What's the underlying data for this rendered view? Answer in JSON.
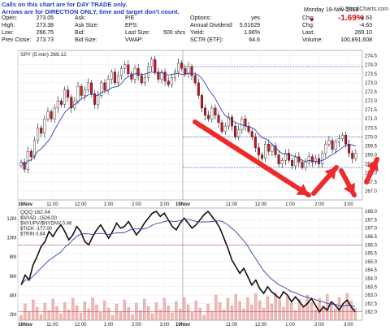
{
  "note_lines": [
    "Calls on this chart are for DAY TRADE only.",
    "Arrows are for DIRECTION ONLY, time and target don't count."
  ],
  "brand": "© StockCharts.com",
  "date": "Monday 19-Nov-2018",
  "change_pct": "-1.69%",
  "quote": {
    "rows": [
      [
        "Open:",
        "273.05",
        "Ask:",
        "",
        "P/E",
        "",
        "Options:",
        "yes",
        "Chg:",
        "-4.63"
      ],
      [
        "High:",
        "273.38",
        "Ask Size:",
        "",
        "EPS:",
        "",
        "Annual Dividend:",
        "5.01629",
        "Chg:",
        "-4.63"
      ],
      [
        "Low:",
        "266.75",
        "Bid:",
        "",
        "Last Size:",
        "500 shrs",
        "Yield:",
        "1.86%",
        "Last:",
        "269.10"
      ],
      [
        "Prev Close:",
        "273.73",
        "Bid Size:",
        "",
        "VWAP:",
        "",
        "SCTR (ETF):",
        "64.6",
        "Volume:",
        "100,891,608"
      ]
    ]
  },
  "chart_data": [
    {
      "type": "candlestick",
      "title": "SPY (5 min) 269.12",
      "ylim": [
        266.5,
        274.8
      ],
      "yticks": [
        267.0,
        267.5,
        268.0,
        268.5,
        269.0,
        269.5,
        270.0,
        270.5,
        271.0,
        271.5,
        272.0,
        272.5,
        273.0,
        273.5,
        274.0,
        274.5
      ],
      "xticks": [
        "16Nov",
        "11:00",
        "12:00",
        "1:00",
        "2:00",
        "3:00",
        "19Nov",
        "11:00",
        "12:00",
        "1:00",
        "2:00",
        "3:00"
      ],
      "levels": [
        273.9,
        270.0,
        268.3
      ],
      "close_path": [
        268.6,
        268.2,
        269.2,
        268.9,
        269.8,
        270.5,
        270.2,
        271.0,
        271.4,
        271.0,
        271.6,
        272.0,
        271.8,
        272.6,
        272.2,
        271.6,
        272.0,
        272.8,
        272.3,
        272.6,
        273.0,
        272.4,
        271.8,
        272.3,
        273.0,
        272.6,
        273.2,
        273.6,
        273.0,
        273.4,
        273.8,
        274.0,
        273.5,
        273.2,
        273.8,
        273.4,
        273.0,
        273.3,
        273.9,
        274.3,
        273.6,
        273.2,
        273.6,
        273.1,
        272.9,
        273.3,
        273.6,
        274.1,
        273.8,
        273.5,
        273.9,
        273.4,
        273.0,
        272.3,
        271.6,
        271.2,
        271.0,
        271.6,
        271.2,
        270.8,
        270.3,
        270.6,
        271.1,
        270.6,
        270.0,
        270.4,
        271.0,
        270.6,
        270.3,
        270.0,
        269.4,
        269.0,
        268.8,
        269.6,
        269.2,
        269.5,
        269.0,
        268.5,
        268.7,
        269.1,
        268.7,
        268.4,
        268.9,
        268.6,
        268.3,
        268.6,
        268.9,
        268.6,
        268.8,
        268.5,
        269.1,
        269.6,
        269.8,
        269.3,
        269.7,
        269.9,
        270.1,
        269.6,
        269.1,
        268.8,
        269.1
      ]
    },
    {
      "type": "line+bar",
      "title": "QQQ 162.04",
      "legend": [
        "$NYAD -1526.00",
        "$NYUPV/$NYDNV 0.46",
        "$TICK -177.00",
        "$TRIN 0.84"
      ],
      "ylim": [
        161.5,
        168.2
      ],
      "yticks": [
        162.0,
        162.5,
        163.0,
        163.5,
        164.0,
        164.5,
        165.0,
        165.5,
        166.0,
        166.5,
        167.0,
        167.5,
        168.0
      ],
      "volume_ticks": [
        "2M",
        "4M",
        "6M",
        "8M",
        "10M",
        "12M"
      ],
      "xticks": [
        "16Nov",
        "11:00",
        "12:00",
        "1:00",
        "2:00",
        "3:00",
        "19Nov",
        "11:00",
        "12:00",
        "1:00",
        "2:00",
        "3:00"
      ],
      "close_path": [
        163.6,
        164.2,
        163.9,
        164.8,
        165.3,
        165.9,
        166.2,
        166.8,
        166.5,
        166.9,
        167.2,
        166.8,
        166.3,
        166.6,
        167.1,
        166.8,
        166.2,
        166.0,
        166.5,
        166.9,
        167.2,
        166.8,
        166.4,
        166.8,
        167.3,
        167.0,
        167.1,
        167.4,
        167.0,
        166.6,
        166.9,
        167.3,
        167.6,
        167.9,
        168.0,
        167.7,
        167.9,
        167.5,
        167.1,
        166.9,
        167.3,
        167.6,
        167.3,
        167.0,
        167.2,
        167.5,
        167.8,
        168.0,
        167.7,
        167.4,
        167.0,
        166.4,
        165.8,
        165.1,
        164.7,
        164.3,
        164.6,
        164.1,
        163.6,
        163.9,
        163.4,
        163.1,
        163.5,
        163.2,
        163.0,
        162.8,
        163.2,
        163.0,
        162.6,
        162.9,
        162.6,
        162.3,
        162.5,
        162.8,
        162.4,
        162.0,
        162.3,
        162.1,
        162.6,
        162.4,
        162.1,
        162.5,
        162.7,
        162.3,
        162.0
      ]
    }
  ]
}
